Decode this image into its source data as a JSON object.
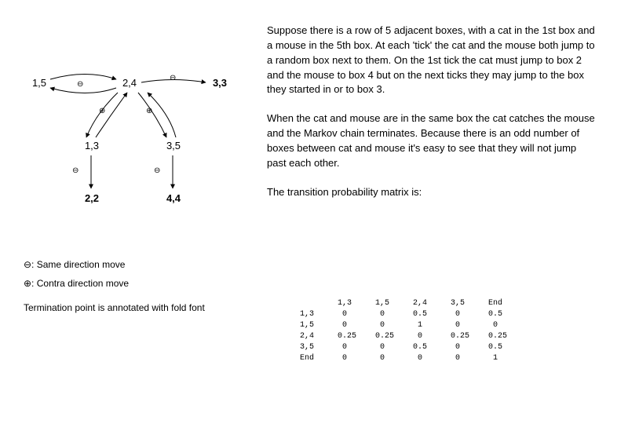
{
  "diagram": {
    "nodes": {
      "n15": "1,5",
      "n24": "2,4",
      "n33": "3,3",
      "n13": "1,3",
      "n35": "3,5",
      "n22": "2,2",
      "n44": "4,4"
    },
    "edge_labels": {
      "e1": "⊖",
      "e2": "⊖",
      "e3": "⊕",
      "e4": "⊕",
      "e5": "⊖",
      "e6": "⊖"
    },
    "legend": {
      "same": "⊖: Same direction move",
      "contra": "⊕: Contra direction move"
    },
    "footnote": "Termination point is annotated with fold font"
  },
  "text": {
    "p1": "Suppose there is a row of 5 adjacent boxes, with a cat in the 1st box and a mouse in the 5th box. At each 'tick' the cat and the mouse both jump to a random box next to them. On the 1st tick the cat must jump to box 2 and the mouse to box 4 but on the next ticks they may jump to the box they started in or to box 3.",
    "p2": "When the cat and mouse are in the same box the cat catches the mouse and the Markov chain terminates. Because there is an odd number of boxes between cat and mouse it's easy to see that they will not jump past each other.",
    "p3": "The transition probability matrix is:"
  },
  "matrix": {
    "header": [
      "",
      "1,3",
      "1,5",
      "2,4",
      "3,5",
      "End"
    ],
    "rows": [
      {
        "label": "1,3",
        "vals": [
          "0",
          "0",
          "0.5",
          "0",
          "0.5"
        ]
      },
      {
        "label": "1,5",
        "vals": [
          "0",
          "0",
          "1",
          "0",
          "0"
        ]
      },
      {
        "label": "2,4",
        "vals": [
          "0.25",
          "0.25",
          "0",
          "0.25",
          "0.25"
        ]
      },
      {
        "label": "3,5",
        "vals": [
          "0",
          "0",
          "0.5",
          "0",
          "0.5"
        ]
      },
      {
        "label": "End",
        "vals": [
          "0",
          "0",
          "0",
          "0",
          "1"
        ]
      }
    ]
  },
  "chart_data": {
    "type": "table",
    "title": "Transition probability matrix",
    "categories": [
      "1,3",
      "1,5",
      "2,4",
      "3,5",
      "End"
    ],
    "series": [
      {
        "name": "1,3",
        "values": [
          0,
          0,
          0.5,
          0,
          0.5
        ]
      },
      {
        "name": "1,5",
        "values": [
          0,
          0,
          1,
          0,
          0
        ]
      },
      {
        "name": "2,4",
        "values": [
          0.25,
          0.25,
          0,
          0.25,
          0.25
        ]
      },
      {
        "name": "3,5",
        "values": [
          0,
          0,
          0.5,
          0,
          0.5
        ]
      },
      {
        "name": "End",
        "values": [
          0,
          0,
          0,
          0,
          1
        ]
      }
    ]
  }
}
